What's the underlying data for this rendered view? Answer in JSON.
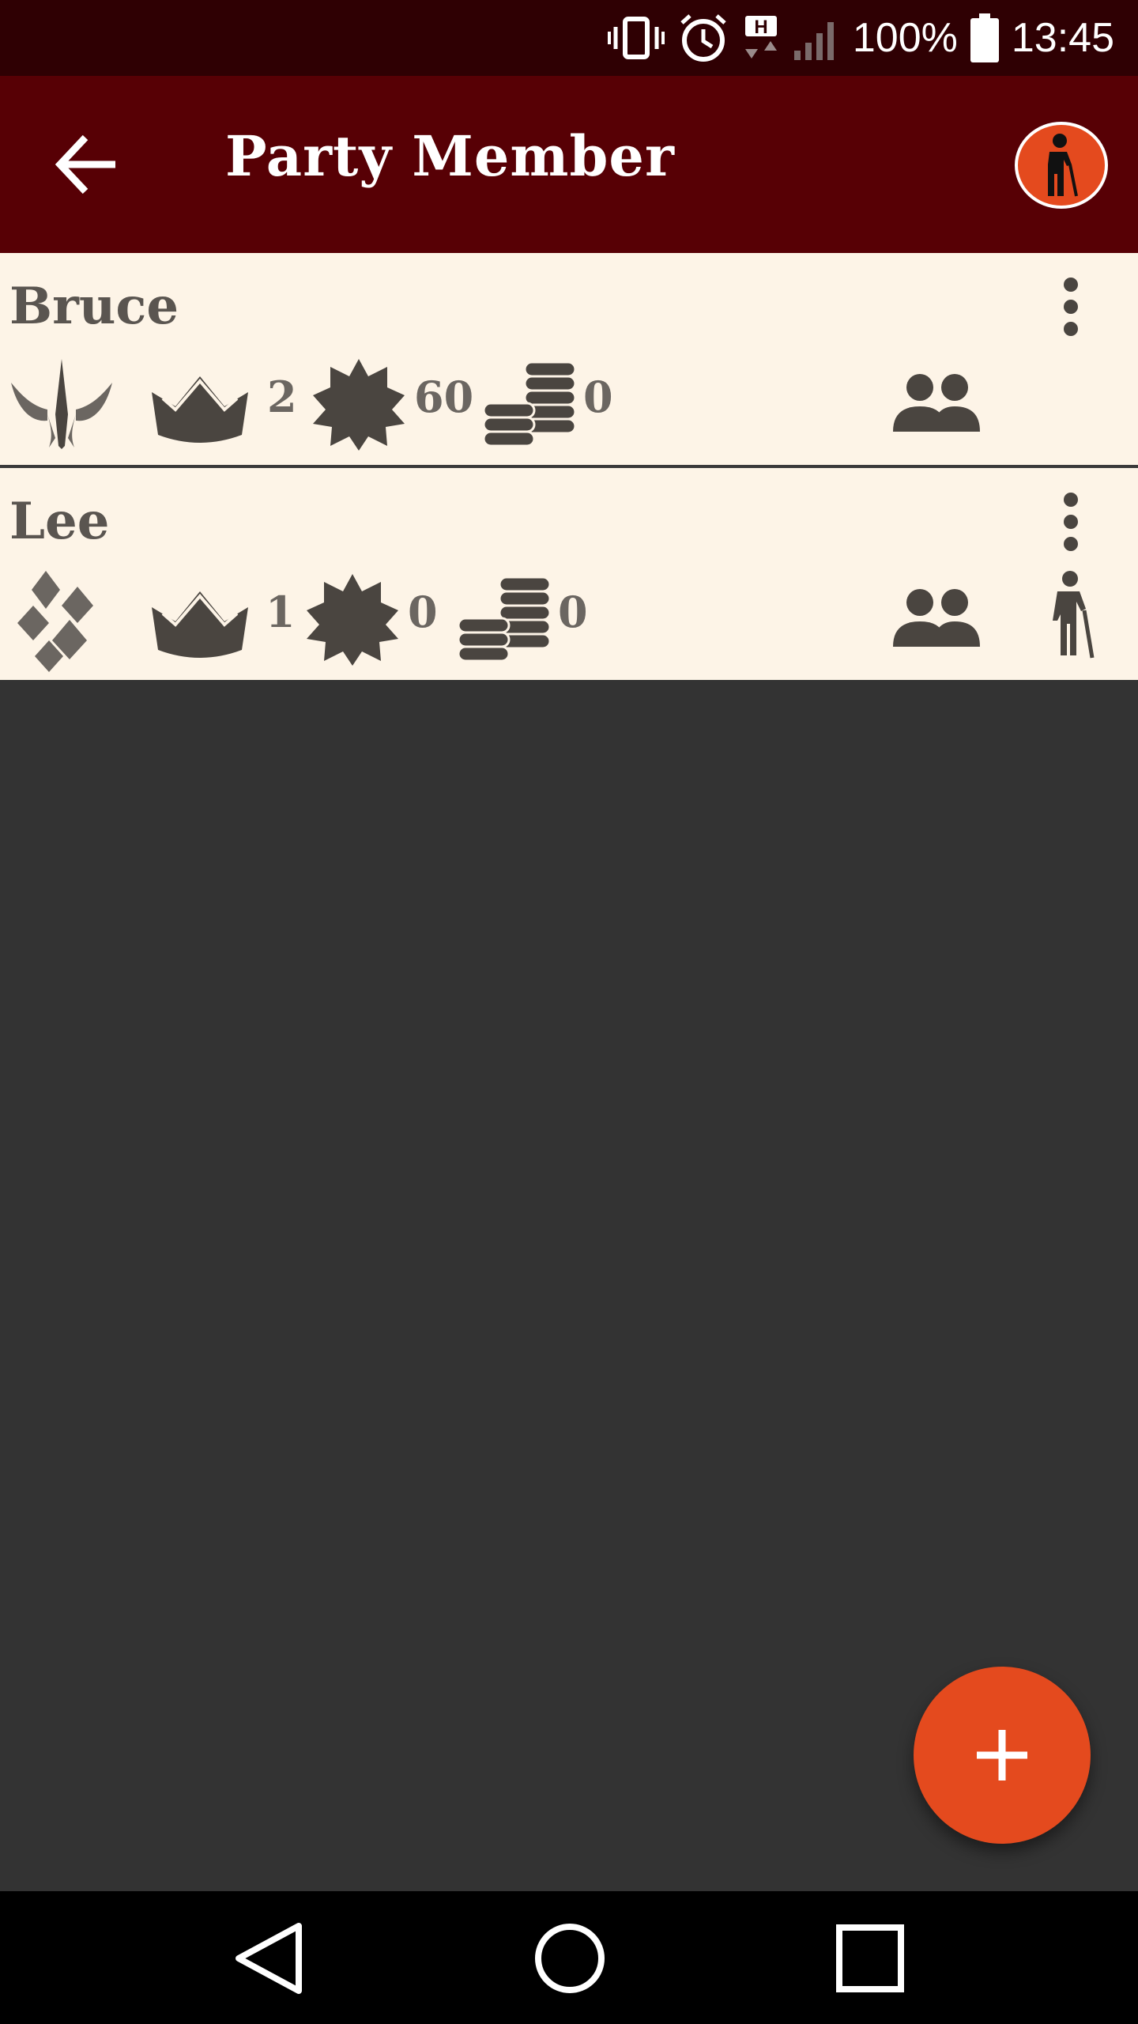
{
  "status_bar": {
    "battery_text": "100%",
    "time": "13:45"
  },
  "app_bar": {
    "title": "Party Member"
  },
  "members": [
    {
      "name": "Bruce",
      "level": "2",
      "xp": "60",
      "gold": "0"
    },
    {
      "name": "Lee",
      "level": "1",
      "xp": "0",
      "gold": "0"
    }
  ],
  "colors": {
    "status_bar_bg": "#2f0003",
    "app_bar_bg": "#570005",
    "card_bg": "#fdf4e7",
    "accent": "#e44a1e",
    "icon": "#4a4540",
    "body_bg": "#333333"
  },
  "icons": {
    "back": "arrow-left-icon",
    "retire": "elderly-person-icon",
    "menu": "more-vertical-icon",
    "level": "crown-icon",
    "xp": "star-burst-icon",
    "gold": "coin-stack-icon",
    "party": "people-icon",
    "add": "plus-icon"
  }
}
